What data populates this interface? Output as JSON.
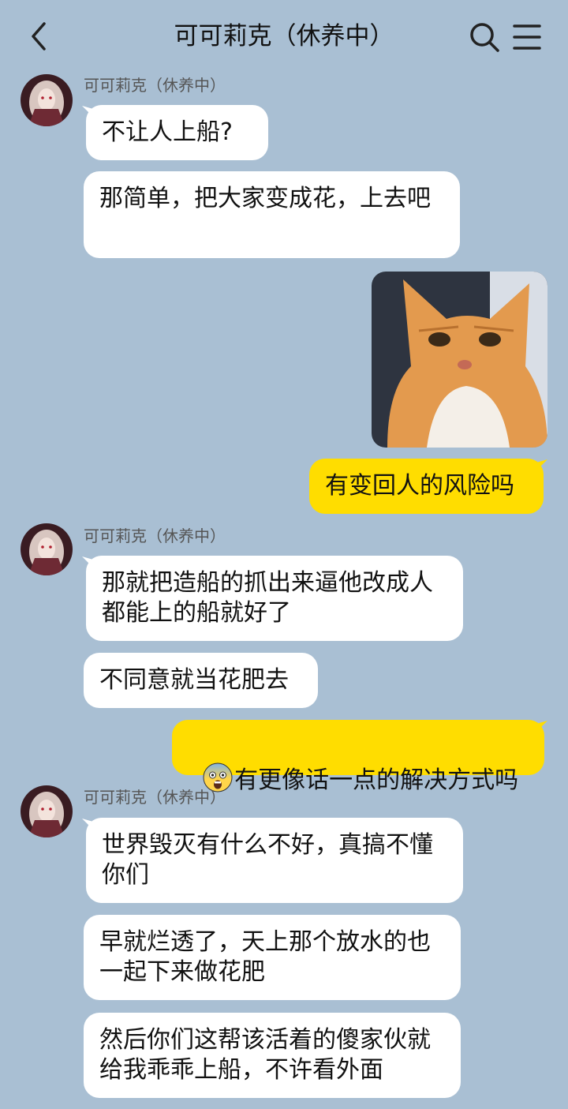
{
  "header": {
    "title": "可可莉克（休养中）",
    "back_icon": "chevron-left-icon",
    "search_icon": "search-icon",
    "menu_icon": "menu-icon"
  },
  "contact": {
    "name": "可可莉克（休养中）"
  },
  "messages": [
    {
      "side": "in",
      "text": "不让人上船?"
    },
    {
      "side": "in",
      "text": "那简单，把大家变成花，上去吧"
    },
    {
      "side": "out",
      "type": "image",
      "description": "cat-photo"
    },
    {
      "side": "out",
      "text": "有变回人的风险吗"
    },
    {
      "side": "in",
      "text": "那就把造船的抓出来逼他改成人都能上的船就好了"
    },
    {
      "side": "in",
      "text": "不同意就当花肥去"
    },
    {
      "side": "out",
      "emoji": "fearful-face-emoji",
      "text": "有更像话一点的解决方式吗"
    },
    {
      "side": "in",
      "text": "世界毁灭有什么不好，真搞不懂你们"
    },
    {
      "side": "in",
      "text": "早就烂透了，天上那个放水的也一起下来做花肥"
    },
    {
      "side": "in",
      "text": "然后你们这帮该活着的傻家伙就给我乖乖上船，不许看外面"
    }
  ],
  "colors": {
    "background": "#a9bfd3",
    "incoming_bubble": "#ffffff",
    "outgoing_bubble": "#ffdd00"
  }
}
